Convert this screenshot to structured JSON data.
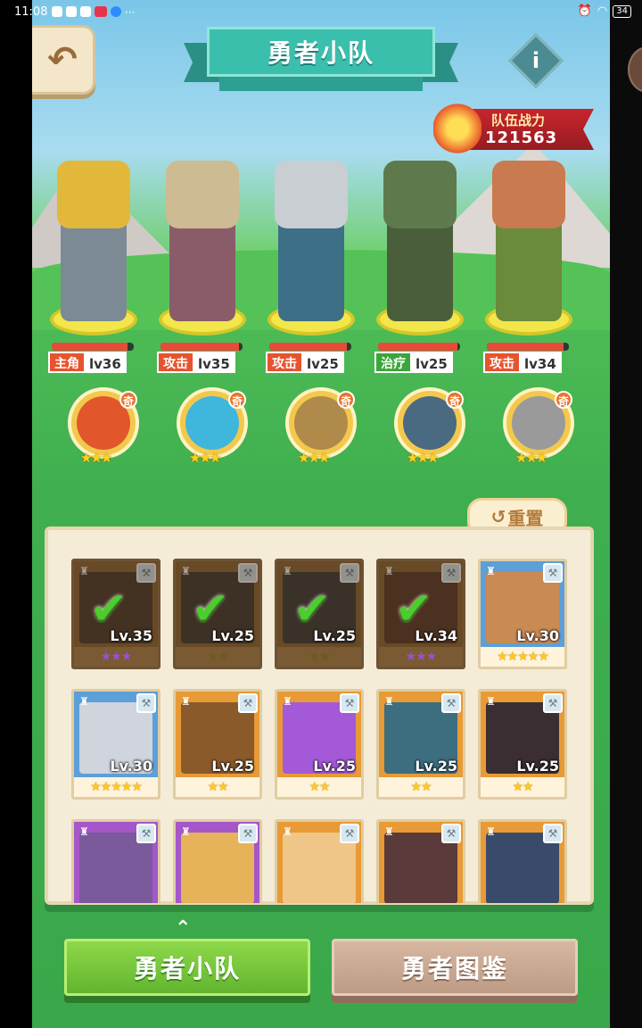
{
  "status_bar": {
    "time": "11:08",
    "battery": "34",
    "more": "···"
  },
  "header": {
    "title": "勇者小队",
    "back_icon": "back-arrow-icon",
    "info_label": "i"
  },
  "team_power": {
    "label": "队伍战力",
    "value": "121563"
  },
  "heroes": [
    {
      "role": "主角",
      "level": "lv36",
      "role_type": "lead",
      "hp": 0.92,
      "color": "#e2b83a",
      "body": "#7b8a94"
    },
    {
      "role": "攻击",
      "level": "lv35",
      "role_type": "attack",
      "hp": 0.96,
      "color": "#cdbb94",
      "body": "#8a5c6a"
    },
    {
      "role": "攻击",
      "level": "lv25",
      "role_type": "attack",
      "hp": 0.95,
      "color": "#c9ced2",
      "body": "#3d6f86"
    },
    {
      "role": "治疗",
      "level": "lv25",
      "role_type": "heal",
      "hp": 0.97,
      "color": "#5e7a4c",
      "body": "#4a5e3c"
    },
    {
      "role": "攻击",
      "level": "lv34",
      "role_type": "attack",
      "hp": 0.94,
      "color": "#c97a4e",
      "body": "#6a8a3c"
    }
  ],
  "pets": [
    {
      "badge": "奇",
      "stars": "★★★",
      "color": "#e2562c"
    },
    {
      "badge": "奇",
      "stars": "★★★",
      "color": "#3fb6dc"
    },
    {
      "badge": "奇",
      "stars": "★★★",
      "color": "#b08a4a"
    },
    {
      "badge": "奇",
      "stars": "★★★",
      "color": "#4a6a82"
    },
    {
      "badge": "奇",
      "stars": "★★★",
      "color": "#9a9a9a"
    }
  ],
  "reset_label": "重置",
  "roster": [
    {
      "level": "Lv.35",
      "stars": "★★★",
      "star_color": "purple",
      "selected": true,
      "frame": "sel",
      "art": "#4a3a2c"
    },
    {
      "level": "Lv.25",
      "stars": "★★",
      "star_color": "dark",
      "selected": true,
      "frame": "sel",
      "art": "#3e3a36"
    },
    {
      "level": "Lv.25",
      "stars": "★★",
      "star_color": "dark",
      "selected": true,
      "frame": "sel",
      "art": "#3a3a3a"
    },
    {
      "level": "Lv.34",
      "stars": "★★★",
      "star_color": "purple",
      "selected": true,
      "frame": "sel",
      "art": "#5a3a2a"
    },
    {
      "level": "Lv.30",
      "stars": "★★★★★",
      "star_color": "gold",
      "selected": false,
      "frame": "blue",
      "art": "#c98a54"
    },
    {
      "level": "Lv.30",
      "stars": "★★★★★",
      "star_color": "gold",
      "selected": false,
      "frame": "blue",
      "art": "#d0d4dc"
    },
    {
      "level": "Lv.25",
      "stars": "★★",
      "star_color": "gold",
      "selected": false,
      "frame": "orange",
      "art": "#8a5a2a"
    },
    {
      "level": "Lv.25",
      "stars": "★★",
      "star_color": "gold",
      "selected": false,
      "frame": "orange",
      "art": "#a45ad8"
    },
    {
      "level": "Lv.25",
      "stars": "★★",
      "star_color": "gold",
      "selected": false,
      "frame": "orange",
      "art": "#3c6e80"
    },
    {
      "level": "Lv.25",
      "stars": "★★",
      "star_color": "gold",
      "selected": false,
      "frame": "orange",
      "art": "#3a2e32"
    },
    {
      "level": "",
      "stars": "",
      "star_color": "gold",
      "selected": false,
      "frame": "purple",
      "art": "#7a5a9a"
    },
    {
      "level": "",
      "stars": "",
      "star_color": "gold",
      "selected": false,
      "frame": "purple",
      "art": "#e6b25a"
    },
    {
      "level": "",
      "stars": "",
      "star_color": "gold",
      "selected": false,
      "frame": "orange",
      "art": "#f0c688"
    },
    {
      "level": "",
      "stars": "",
      "star_color": "gold",
      "selected": false,
      "frame": "orange",
      "art": "#5a3a3a"
    },
    {
      "level": "",
      "stars": "",
      "star_color": "gold",
      "selected": false,
      "frame": "orange",
      "art": "#3a4a6a"
    }
  ],
  "tabs": {
    "chevron": "⌃",
    "team": "勇者小队",
    "codex": "勇者图鉴"
  }
}
